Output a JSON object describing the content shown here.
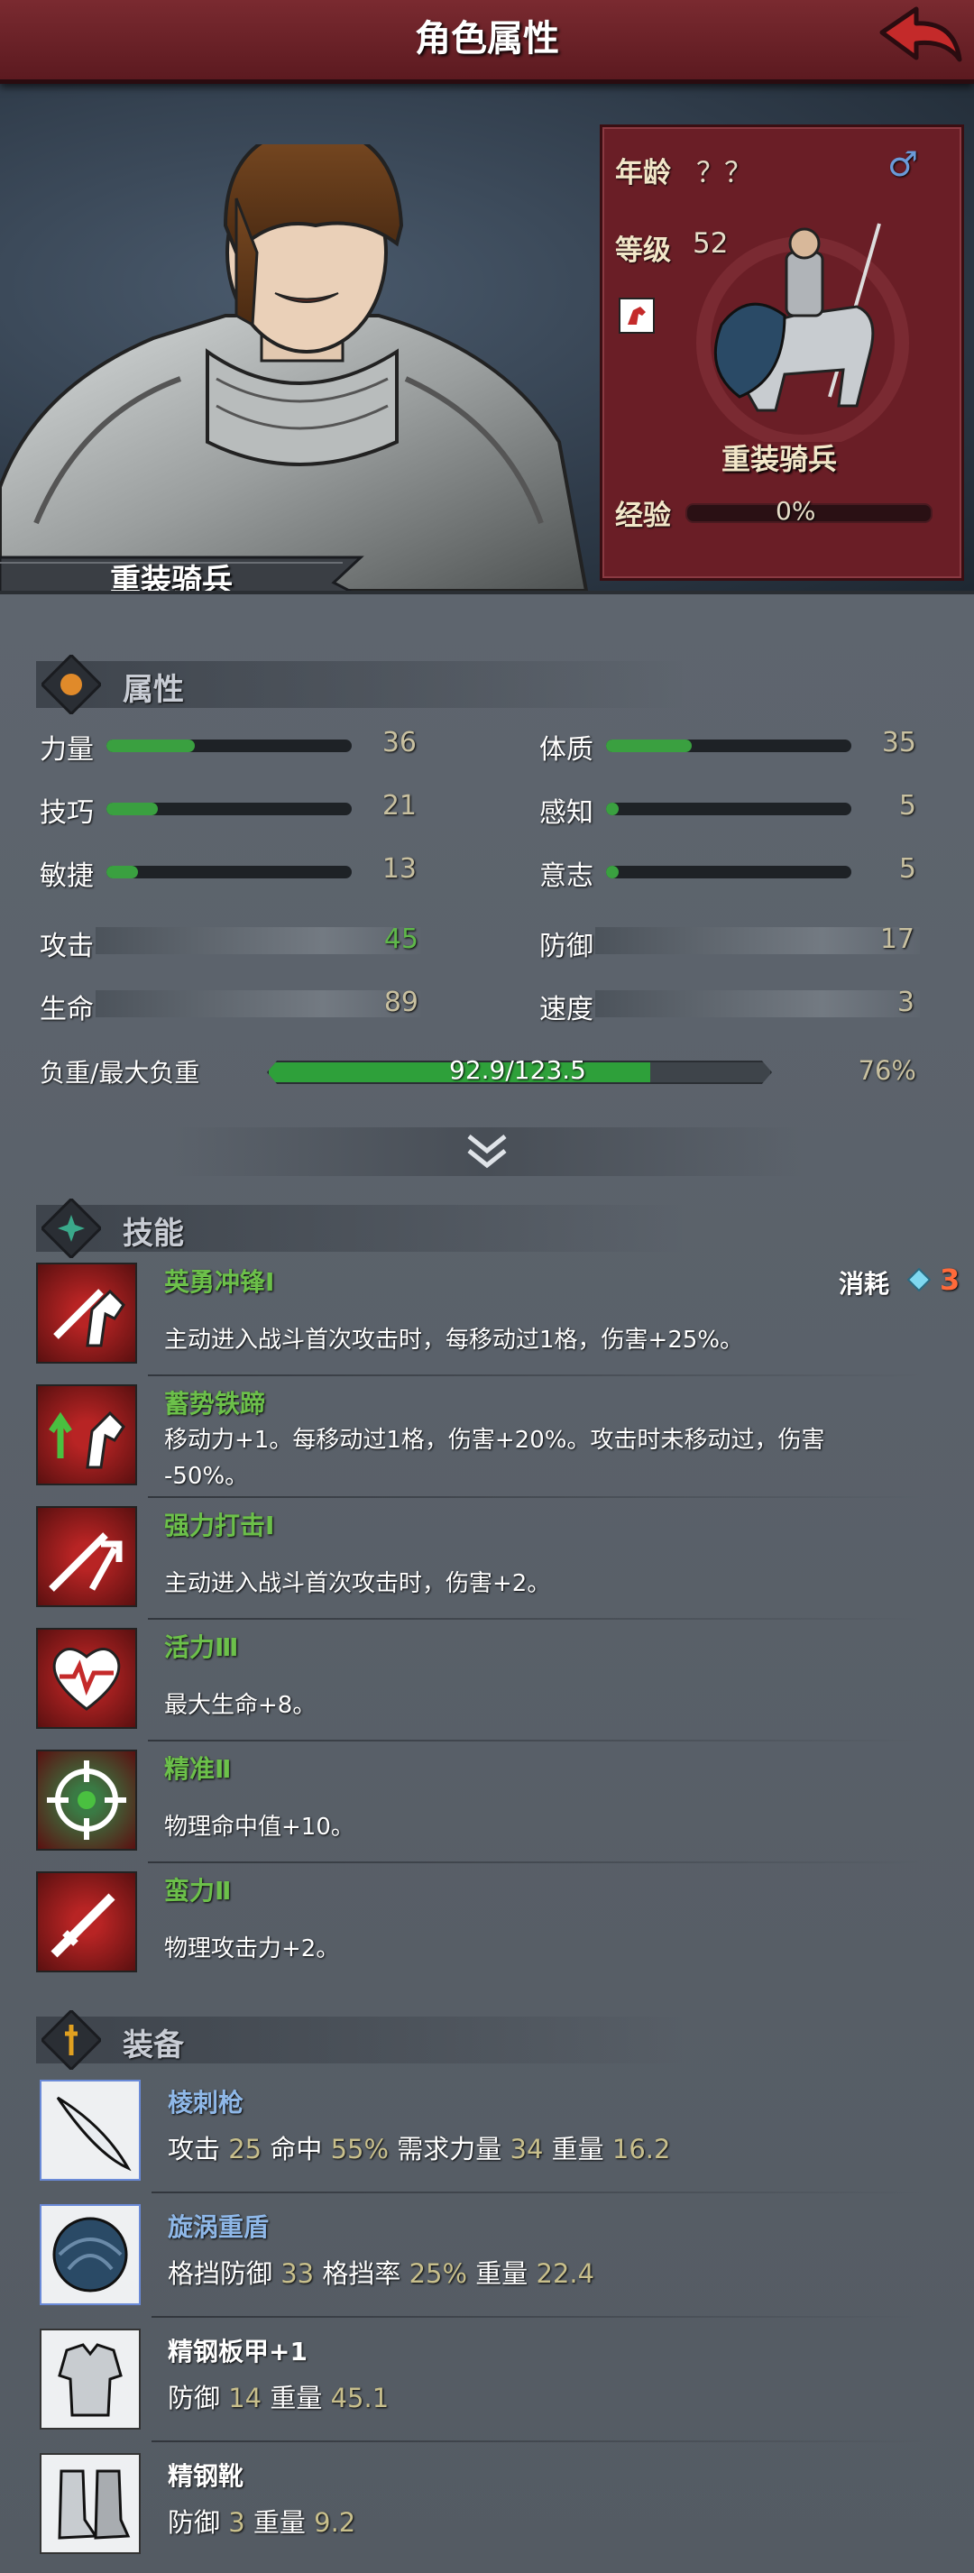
{
  "header": {
    "title": "角色属性"
  },
  "hero": {
    "class_name": "重装骑兵"
  },
  "card": {
    "age_label": "年龄",
    "age_value": "？？",
    "gender_symbol": "♂",
    "level_label": "等级",
    "level_value": "52",
    "unit_name": "重装骑兵",
    "exp_label": "经验",
    "exp_value": "0%",
    "exp_fraction": 0
  },
  "attributes": {
    "title": "属性",
    "primary": [
      {
        "label": "力量",
        "value": "36",
        "fill": 0.36
      },
      {
        "label": "体质",
        "value": "35",
        "fill": 0.35
      },
      {
        "label": "技巧",
        "value": "21",
        "fill": 0.21
      },
      {
        "label": "感知",
        "value": "5",
        "fill": 0.05
      },
      {
        "label": "敏捷",
        "value": "13",
        "fill": 0.13
      },
      {
        "label": "意志",
        "value": "5",
        "fill": 0.05
      }
    ],
    "stats": [
      {
        "label": "攻击",
        "value": "45"
      },
      {
        "label": "防御",
        "value": "17"
      },
      {
        "label": "生命",
        "value": "89"
      },
      {
        "label": "速度",
        "value": "3"
      }
    ],
    "load_label": "负重/最大负重",
    "load_value": "92.9/123.5",
    "load_percent": "76%",
    "load_fraction": 0.76
  },
  "skills": {
    "title": "技能",
    "cost_label": "消耗",
    "cost_value": "3",
    "items": [
      {
        "name": "英勇冲锋Ⅰ",
        "desc": [
          "主动进入战斗首次攻击时，每移动过1格，伤害+25%。"
        ],
        "icon": "horse-sword-icon"
      },
      {
        "name": "蓄势铁蹄",
        "desc": [
          "移动力+1。每移动过1格，伤害+20%。攻击时未移动过，伤害",
          "-50%。"
        ],
        "icon": "horse-arrow-up-icon"
      },
      {
        "name": "强力打击Ⅰ",
        "desc": [
          "主动进入战斗首次攻击时，伤害+2。"
        ],
        "icon": "sword-arrow-icon"
      },
      {
        "name": "活力Ⅲ",
        "desc": [
          "最大生命+8。"
        ],
        "icon": "heart-pulse-icon"
      },
      {
        "name": "精准Ⅱ",
        "desc": [
          "物理命中值+10。"
        ],
        "icon": "crosshair-icon"
      },
      {
        "name": "蛮力Ⅱ",
        "desc": [
          "物理攻击力+2。"
        ],
        "icon": "sword-icon"
      }
    ]
  },
  "equipment": {
    "title": "装备",
    "items": [
      {
        "name": "棱刺枪",
        "name_color": "#8fb8e8",
        "icon": "lance-icon",
        "stats": [
          [
            "攻击",
            "25"
          ],
          [
            "命中",
            "55%"
          ],
          [
            "需求力量",
            "34"
          ],
          [
            "重量",
            "16.2"
          ]
        ]
      },
      {
        "name": "旋涡重盾",
        "name_color": "#8fb8e8",
        "icon": "shield-icon",
        "stats": [
          [
            "格挡防御",
            "33"
          ],
          [
            "格挡率",
            "25%"
          ],
          [
            "重量",
            "22.4"
          ]
        ]
      },
      {
        "name": "精钢板甲+1",
        "name_color": "#ffffff",
        "icon": "plate-armor-icon",
        "stats": [
          [
            "防御",
            "14"
          ],
          [
            "重量",
            "45.1"
          ]
        ]
      },
      {
        "name": "精钢靴",
        "name_color": "#ffffff",
        "icon": "steel-boots-icon",
        "stats": [
          [
            "防御",
            "3"
          ],
          [
            "重量",
            "9.2"
          ]
        ]
      }
    ]
  },
  "colors": {
    "green": "#3aa040",
    "skill_green": "#6cc04a",
    "header_red": "#6a1e26",
    "cost_red": "#ff6a3a",
    "gem_blue": "#7fd8f0"
  }
}
